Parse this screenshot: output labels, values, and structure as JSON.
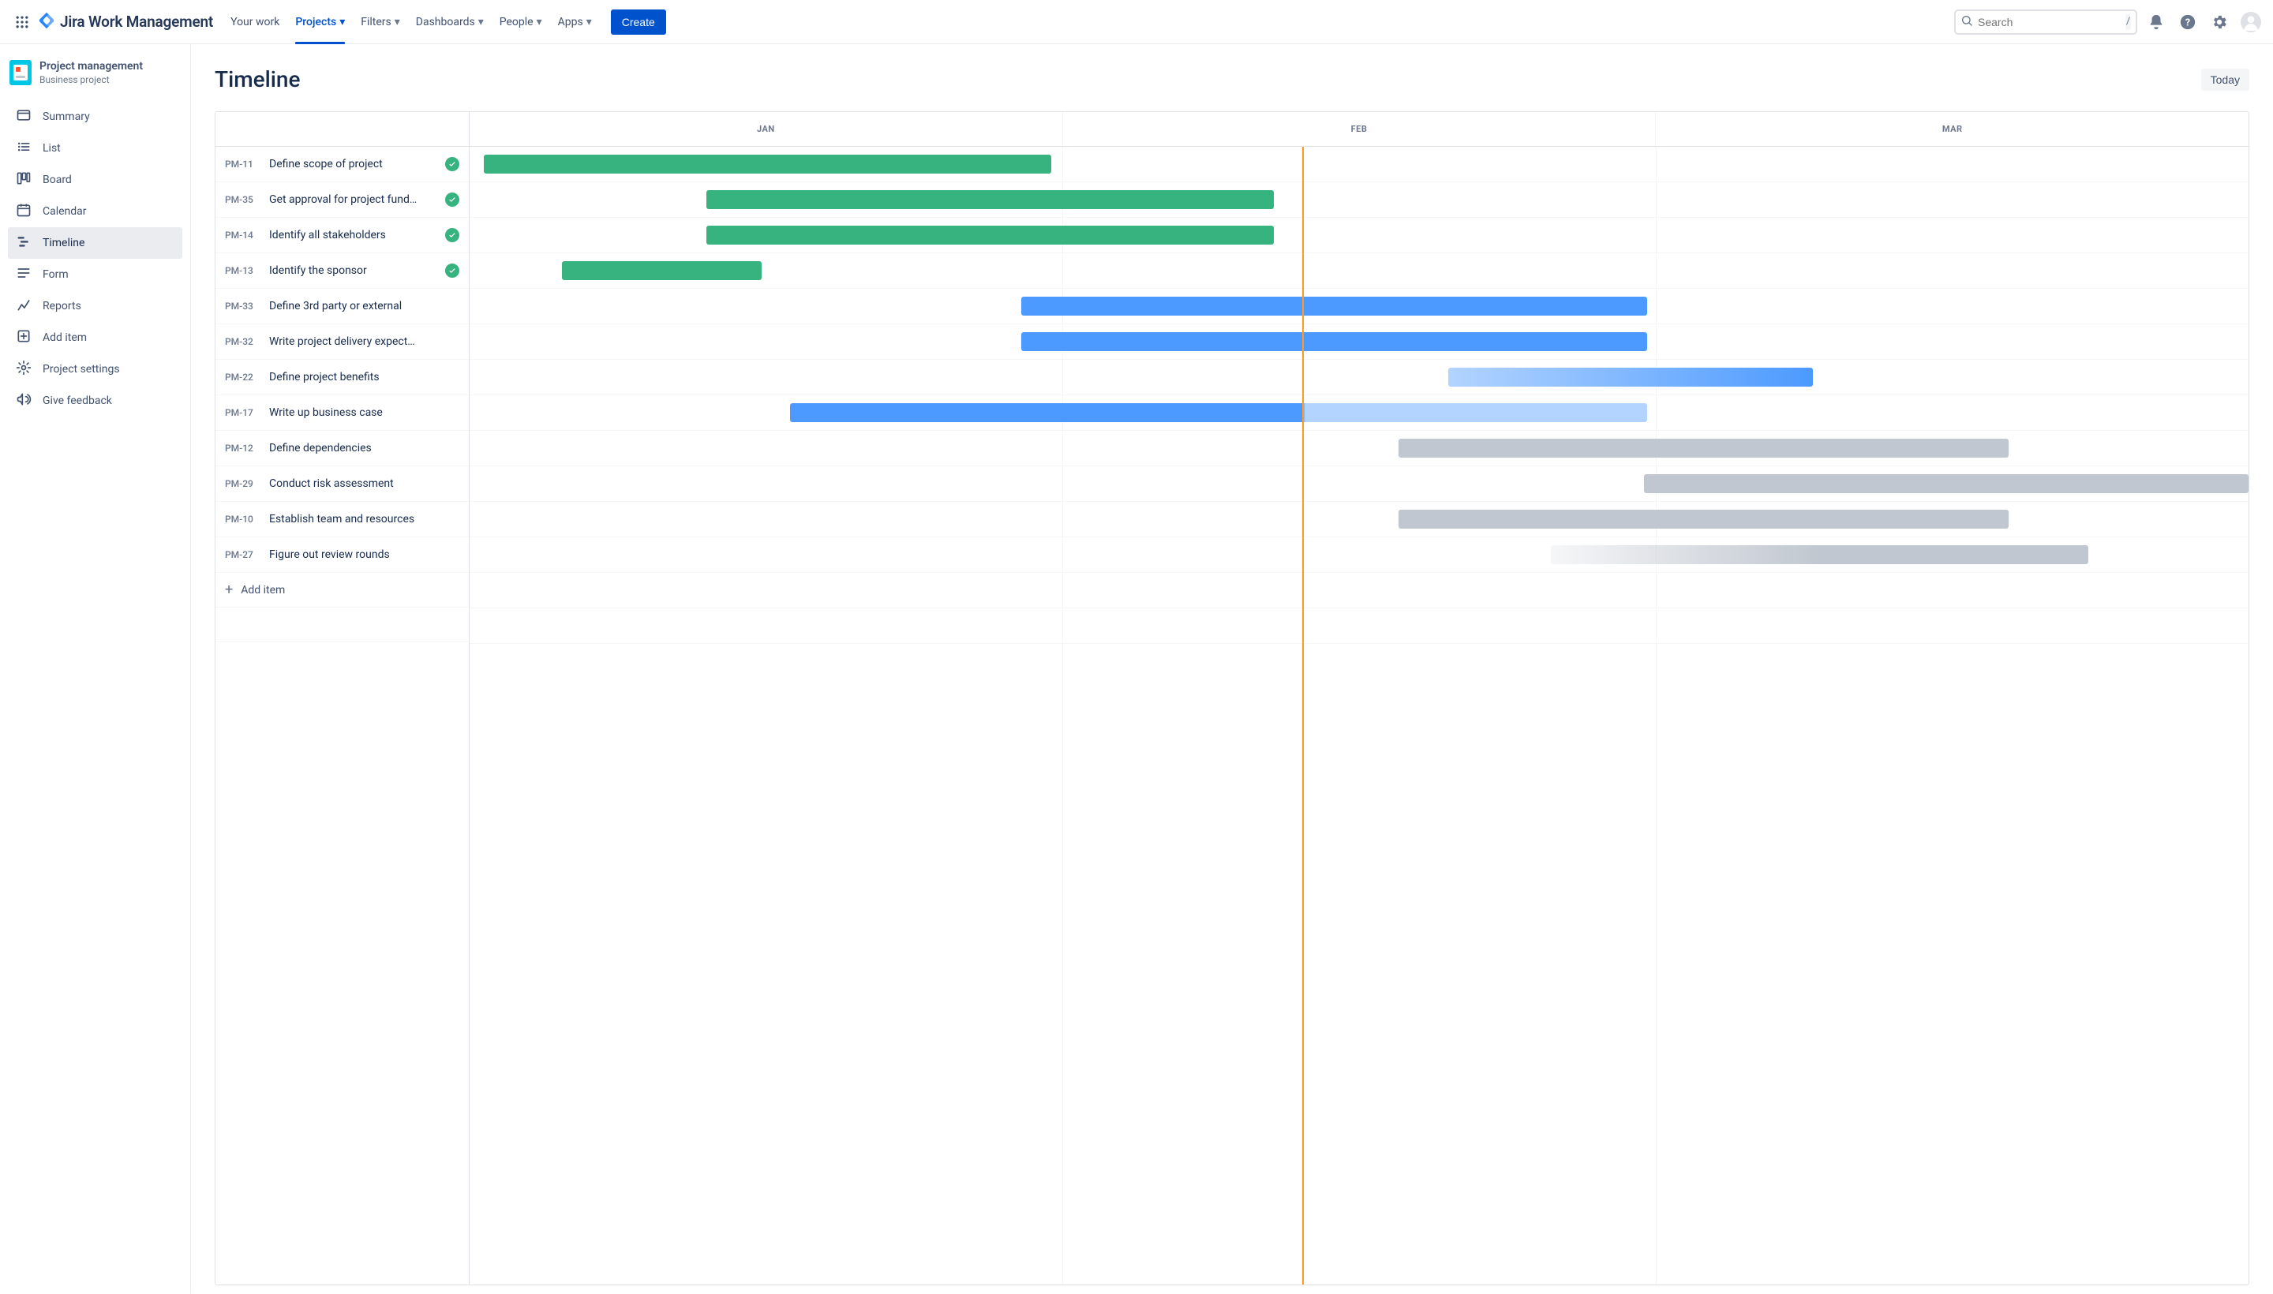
{
  "app": {
    "name": "Jira Work Management"
  },
  "nav": {
    "your_work": "Your work",
    "projects": "Projects",
    "filters": "Filters",
    "dashboards": "Dashboards",
    "people": "People",
    "apps": "Apps",
    "create": "Create"
  },
  "search": {
    "placeholder": "Search",
    "slash": "/"
  },
  "project": {
    "name": "Project management",
    "type": "Business project"
  },
  "sidebar": {
    "summary": "Summary",
    "list": "List",
    "board": "Board",
    "calendar": "Calendar",
    "timeline": "Timeline",
    "form": "Form",
    "reports": "Reports",
    "add_item": "Add item",
    "settings": "Project settings",
    "feedback": "Give feedback"
  },
  "page": {
    "title": "Timeline",
    "today": "Today",
    "add_item": "Add item"
  },
  "months": [
    "JAN",
    "FEB",
    "MAR"
  ],
  "today_line_pct": 46.8,
  "tasks": [
    {
      "id": "PM-11",
      "title": "Define scope of project",
      "done": true,
      "color": "green",
      "start": 0.8,
      "end": 32.7
    },
    {
      "id": "PM-35",
      "title": "Get approval for project fund…",
      "done": true,
      "color": "green",
      "start": 13.3,
      "end": 45.2
    },
    {
      "id": "PM-14",
      "title": "Identify all stakeholders",
      "done": true,
      "color": "green",
      "start": 13.3,
      "end": 45.2
    },
    {
      "id": "PM-13",
      "title": "Identify the sponsor",
      "done": true,
      "color": "green",
      "start": 5.2,
      "end": 16.4
    },
    {
      "id": "PM-33",
      "title": "Define 3rd party or external",
      "done": false,
      "color": "blue",
      "start": 31.0,
      "end": 66.2
    },
    {
      "id": "PM-32",
      "title": "Write project delivery expect…",
      "done": false,
      "color": "blue",
      "start": 31.0,
      "end": 66.2
    },
    {
      "id": "PM-22",
      "title": "Define project benefits",
      "done": false,
      "color": "blue-g",
      "start": 55.0,
      "end": 75.5
    },
    {
      "id": "PM-17",
      "title": "Write up business case",
      "done": false,
      "color": "progress-a",
      "start": 18.0,
      "end": 66.2
    },
    {
      "id": "PM-12",
      "title": "Define dependencies",
      "done": false,
      "color": "gray",
      "start": 52.2,
      "end": 86.5
    },
    {
      "id": "PM-29",
      "title": "Conduct risk assessment",
      "done": false,
      "color": "gray",
      "start": 66.0,
      "end": 100.0
    },
    {
      "id": "PM-10",
      "title": "Establish team and resources",
      "done": false,
      "color": "gray",
      "start": 52.2,
      "end": 86.5
    },
    {
      "id": "PM-27",
      "title": "Figure out review rounds",
      "done": false,
      "color": "gray-l",
      "start": 60.8,
      "end": 91.0
    }
  ]
}
